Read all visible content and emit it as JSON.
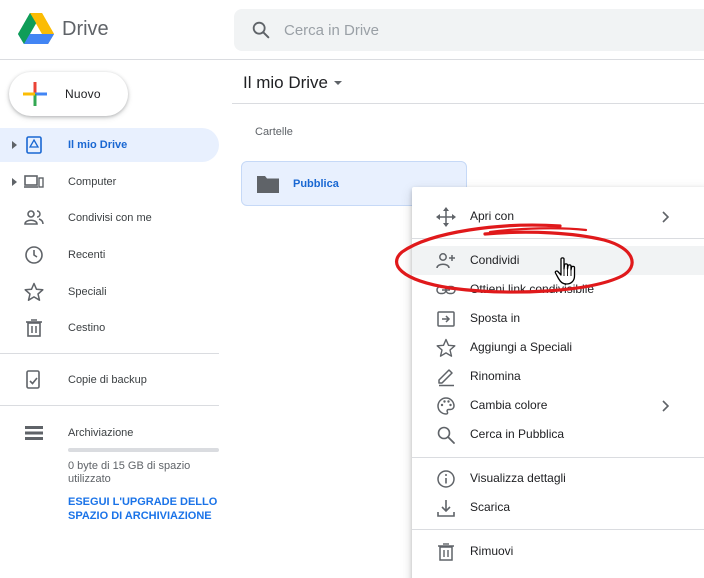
{
  "header": {
    "app_title": "Drive",
    "search_placeholder": "Cerca in Drive",
    "search_value": ""
  },
  "sidebar": {
    "new_label": "Nuovo",
    "items": [
      {
        "label": "Il mio Drive",
        "icon": "my-drive-icon",
        "active": true
      },
      {
        "label": "Computer",
        "icon": "computer-icon",
        "active": false
      },
      {
        "label": "Condivisi con me",
        "icon": "shared-people-icon",
        "active": false
      },
      {
        "label": "Recenti",
        "icon": "clock-icon",
        "active": false
      },
      {
        "label": "Speciali",
        "icon": "star-icon",
        "active": false
      },
      {
        "label": "Cestino",
        "icon": "trash-icon",
        "active": false
      }
    ],
    "backup_label": "Copie di backup",
    "storage_label": "Archiviazione",
    "storage_used_fraction": 0,
    "storage_text": "0 byte di 15 GB di spazio utilizzato",
    "upgrade_text": "ESEGUI L'UPGRADE DELLO SPAZIO DI ARCHIVIAZIONE"
  },
  "main": {
    "title": "Il mio Drive",
    "section_label": "Cartelle",
    "folder_name": "Pubblica"
  },
  "context_menu": {
    "items": [
      {
        "label": "Apri con",
        "icon": "move-arrows-icon"
      },
      {
        "label": "Condividi",
        "icon": "add-person-icon"
      },
      {
        "label": "Ottieni link condivisibile",
        "icon": "link-icon"
      },
      {
        "label": "Sposta in",
        "icon": "move-to-folder-icon"
      },
      {
        "label": "Aggiungi a Speciali",
        "icon": "star-outline-icon"
      },
      {
        "label": "Rinomina",
        "icon": "pencil-icon"
      },
      {
        "label": "Cambia colore",
        "icon": "palette-icon"
      },
      {
        "label": "Cerca in Pubblica",
        "icon": "search-icon"
      },
      {
        "label": "Visualizza dettagli",
        "icon": "info-icon"
      },
      {
        "label": "Scarica",
        "icon": "download-icon"
      },
      {
        "label": "Rimuovi",
        "icon": "trash-icon"
      }
    ]
  },
  "colors": {
    "accent": "#1a73e8",
    "active_bg": "#e8f0fe",
    "annotation_red": "#e0191b"
  }
}
